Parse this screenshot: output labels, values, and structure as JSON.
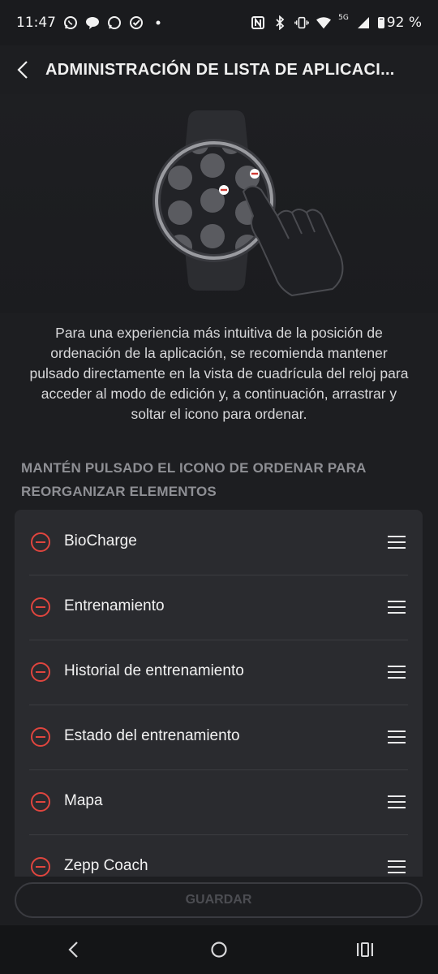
{
  "status_bar": {
    "time": "11:47",
    "network_type": "5G",
    "battery": "92 %",
    "left_icons": [
      "whatsapp-icon",
      "chat-bubble-icon",
      "message-icon",
      "check-circle-icon",
      "dot-icon"
    ],
    "right_icons": [
      "nfc-icon",
      "bluetooth-icon",
      "vibrate-icon",
      "wifi-icon",
      "signal-icon",
      "battery-icon"
    ]
  },
  "header": {
    "title": "ADMINISTRACIÓN DE LISTA DE APLICACI...",
    "back_icon": "chevron-left-icon"
  },
  "hero": {
    "illustration": "watch-drag-illustration"
  },
  "description": "Para una experiencia más intuitiva de la posición de ordenación de la aplicación, se recomienda mantener pulsado directamente en la vista de cuadrícula del reloj para acceder al modo de edición y, a continuación, arrastrar y soltar el icono para ordenar.",
  "section_label": "MANTÉN PULSADO EL ICONO DE ORDENAR PARA REORGANIZAR ELEMENTOS",
  "apps": [
    {
      "label": "BioCharge"
    },
    {
      "label": "Entrenamiento"
    },
    {
      "label": "Historial de entrenamiento"
    },
    {
      "label": "Estado del entrenamiento"
    },
    {
      "label": "Mapa"
    },
    {
      "label": "Zepp Coach"
    }
  ],
  "save_button": "GUARDAR",
  "nav": [
    "back-icon",
    "home-icon",
    "recents-icon"
  ],
  "colors": {
    "accent_remove": "#e0453e",
    "background": "#1d1e21",
    "card": "#2a2b2f",
    "disabled_text": "#4c4d52"
  }
}
